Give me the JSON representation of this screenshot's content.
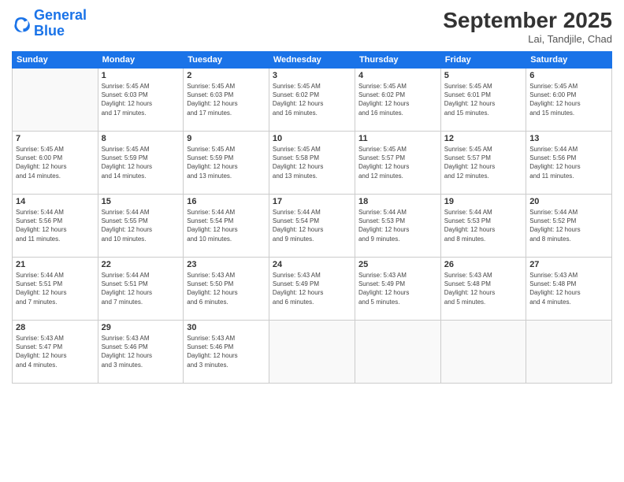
{
  "logo": {
    "line1": "General",
    "line2": "Blue"
  },
  "title": "September 2025",
  "subtitle": "Lai, Tandjile, Chad",
  "days_of_week": [
    "Sunday",
    "Monday",
    "Tuesday",
    "Wednesday",
    "Thursday",
    "Friday",
    "Saturday"
  ],
  "weeks": [
    [
      {
        "day": "",
        "info": ""
      },
      {
        "day": "1",
        "info": "Sunrise: 5:45 AM\nSunset: 6:03 PM\nDaylight: 12 hours\nand 17 minutes."
      },
      {
        "day": "2",
        "info": "Sunrise: 5:45 AM\nSunset: 6:03 PM\nDaylight: 12 hours\nand 17 minutes."
      },
      {
        "day": "3",
        "info": "Sunrise: 5:45 AM\nSunset: 6:02 PM\nDaylight: 12 hours\nand 16 minutes."
      },
      {
        "day": "4",
        "info": "Sunrise: 5:45 AM\nSunset: 6:02 PM\nDaylight: 12 hours\nand 16 minutes."
      },
      {
        "day": "5",
        "info": "Sunrise: 5:45 AM\nSunset: 6:01 PM\nDaylight: 12 hours\nand 15 minutes."
      },
      {
        "day": "6",
        "info": "Sunrise: 5:45 AM\nSunset: 6:00 PM\nDaylight: 12 hours\nand 15 minutes."
      }
    ],
    [
      {
        "day": "7",
        "info": "Sunrise: 5:45 AM\nSunset: 6:00 PM\nDaylight: 12 hours\nand 14 minutes."
      },
      {
        "day": "8",
        "info": "Sunrise: 5:45 AM\nSunset: 5:59 PM\nDaylight: 12 hours\nand 14 minutes."
      },
      {
        "day": "9",
        "info": "Sunrise: 5:45 AM\nSunset: 5:59 PM\nDaylight: 12 hours\nand 13 minutes."
      },
      {
        "day": "10",
        "info": "Sunrise: 5:45 AM\nSunset: 5:58 PM\nDaylight: 12 hours\nand 13 minutes."
      },
      {
        "day": "11",
        "info": "Sunrise: 5:45 AM\nSunset: 5:57 PM\nDaylight: 12 hours\nand 12 minutes."
      },
      {
        "day": "12",
        "info": "Sunrise: 5:45 AM\nSunset: 5:57 PM\nDaylight: 12 hours\nand 12 minutes."
      },
      {
        "day": "13",
        "info": "Sunrise: 5:44 AM\nSunset: 5:56 PM\nDaylight: 12 hours\nand 11 minutes."
      }
    ],
    [
      {
        "day": "14",
        "info": "Sunrise: 5:44 AM\nSunset: 5:56 PM\nDaylight: 12 hours\nand 11 minutes."
      },
      {
        "day": "15",
        "info": "Sunrise: 5:44 AM\nSunset: 5:55 PM\nDaylight: 12 hours\nand 10 minutes."
      },
      {
        "day": "16",
        "info": "Sunrise: 5:44 AM\nSunset: 5:54 PM\nDaylight: 12 hours\nand 10 minutes."
      },
      {
        "day": "17",
        "info": "Sunrise: 5:44 AM\nSunset: 5:54 PM\nDaylight: 12 hours\nand 9 minutes."
      },
      {
        "day": "18",
        "info": "Sunrise: 5:44 AM\nSunset: 5:53 PM\nDaylight: 12 hours\nand 9 minutes."
      },
      {
        "day": "19",
        "info": "Sunrise: 5:44 AM\nSunset: 5:53 PM\nDaylight: 12 hours\nand 8 minutes."
      },
      {
        "day": "20",
        "info": "Sunrise: 5:44 AM\nSunset: 5:52 PM\nDaylight: 12 hours\nand 8 minutes."
      }
    ],
    [
      {
        "day": "21",
        "info": "Sunrise: 5:44 AM\nSunset: 5:51 PM\nDaylight: 12 hours\nand 7 minutes."
      },
      {
        "day": "22",
        "info": "Sunrise: 5:44 AM\nSunset: 5:51 PM\nDaylight: 12 hours\nand 7 minutes."
      },
      {
        "day": "23",
        "info": "Sunrise: 5:43 AM\nSunset: 5:50 PM\nDaylight: 12 hours\nand 6 minutes."
      },
      {
        "day": "24",
        "info": "Sunrise: 5:43 AM\nSunset: 5:49 PM\nDaylight: 12 hours\nand 6 minutes."
      },
      {
        "day": "25",
        "info": "Sunrise: 5:43 AM\nSunset: 5:49 PM\nDaylight: 12 hours\nand 5 minutes."
      },
      {
        "day": "26",
        "info": "Sunrise: 5:43 AM\nSunset: 5:48 PM\nDaylight: 12 hours\nand 5 minutes."
      },
      {
        "day": "27",
        "info": "Sunrise: 5:43 AM\nSunset: 5:48 PM\nDaylight: 12 hours\nand 4 minutes."
      }
    ],
    [
      {
        "day": "28",
        "info": "Sunrise: 5:43 AM\nSunset: 5:47 PM\nDaylight: 12 hours\nand 4 minutes."
      },
      {
        "day": "29",
        "info": "Sunrise: 5:43 AM\nSunset: 5:46 PM\nDaylight: 12 hours\nand 3 minutes."
      },
      {
        "day": "30",
        "info": "Sunrise: 5:43 AM\nSunset: 5:46 PM\nDaylight: 12 hours\nand 3 minutes."
      },
      {
        "day": "",
        "info": ""
      },
      {
        "day": "",
        "info": ""
      },
      {
        "day": "",
        "info": ""
      },
      {
        "day": "",
        "info": ""
      }
    ]
  ]
}
